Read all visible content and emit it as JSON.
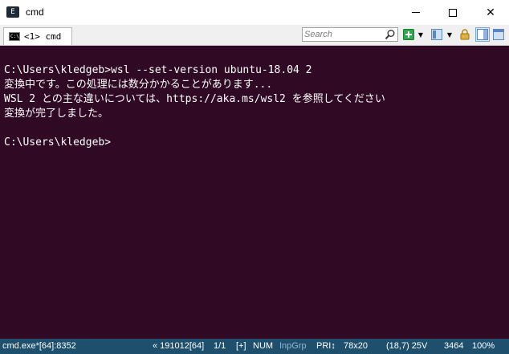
{
  "window": {
    "title": "cmd",
    "minimize_glyph": "—",
    "maximize_glyph": "☐",
    "close_glyph": "✕"
  },
  "tab": {
    "icon_text": "C:\\_",
    "label": "<1> cmd"
  },
  "toolbar": {
    "search_placeholder": "Search",
    "icons": [
      "search-icon",
      "add-console-icon",
      "layout-icon",
      "lock-icon",
      "split-view-icon",
      "panel-icon"
    ]
  },
  "console": {
    "lines": [
      "C:\\Users\\kledgeb>wsl --set-version ubuntu-18.04 2",
      "変換中です。この処理には数分かかることがあります...",
      "WSL 2 との主な違いについては、https://aka.ms/wsl2 を参照してください",
      "変換が完了しました。",
      "",
      "C:\\Users\\kledgeb>"
    ]
  },
  "statusbar": {
    "process": "cmd.exe*[64]:8352",
    "build": "« 191012[64]",
    "page": "1/1",
    "plus": "[+]",
    "num": "NUM",
    "inpgrp": "InpGrp",
    "pri": "PRI↕",
    "size": "78x20",
    "cursor": "(18,7) 25V",
    "pid": "3464",
    "zoom": "100%"
  },
  "colors": {
    "console_bg": "#300a24",
    "console_fg": "#ffffff",
    "statusbar_bg": "#1e4f6c",
    "tabbar_bg": "#f0f0f0"
  }
}
